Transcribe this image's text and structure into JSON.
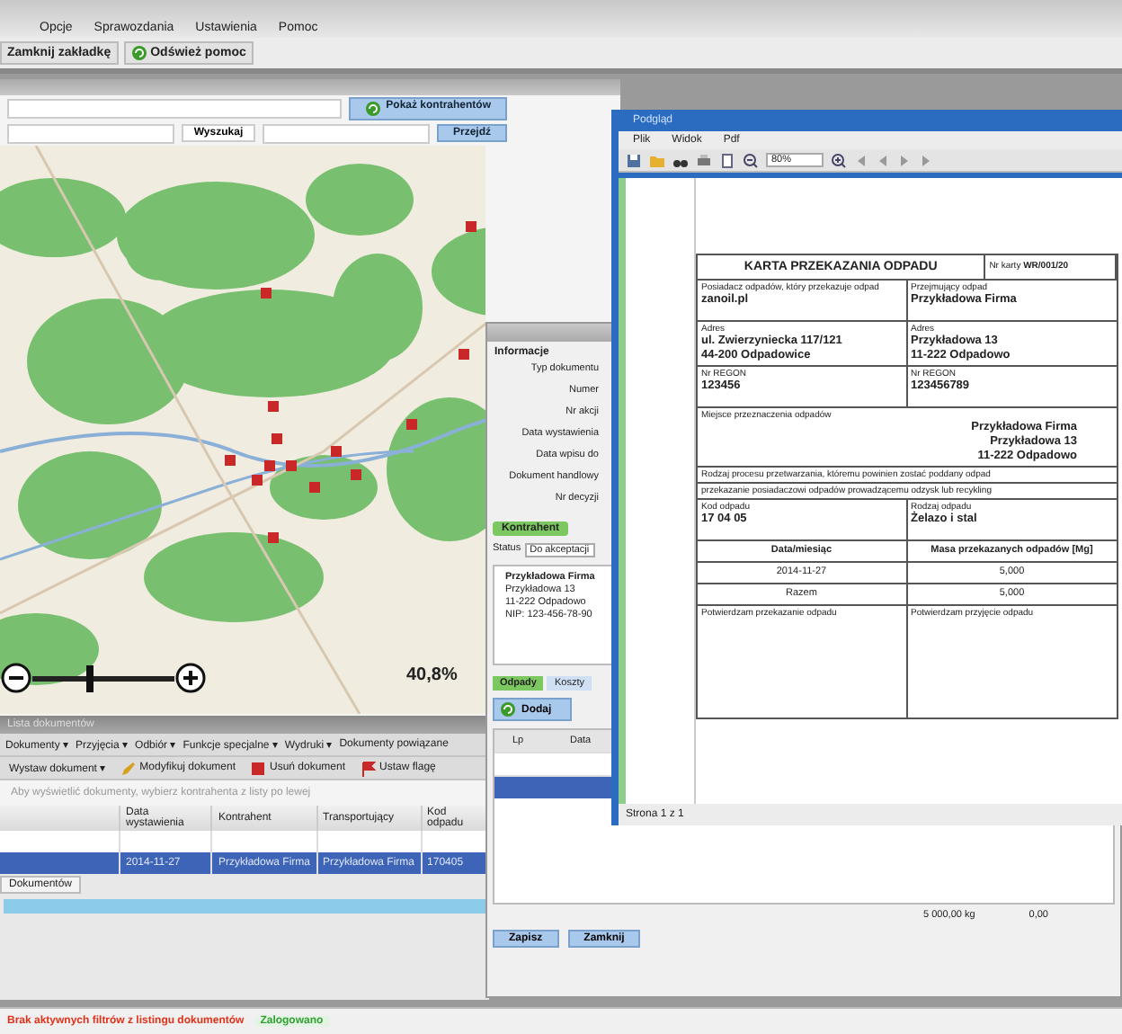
{
  "menu": [
    {
      "label": "Opcje"
    },
    {
      "label": "Sprawozdania"
    },
    {
      "label": "Ustawienia"
    },
    {
      "label": "Pomoc"
    }
  ],
  "toolbar": [
    {
      "label": "Zamknij zakładkę",
      "kind": "plain"
    },
    {
      "label": "Odśwież pomoc",
      "kind": "refresh"
    }
  ],
  "map": {
    "filter_button": "Pokaż kontrahentów",
    "search_button": "Wyszukaj",
    "go_button": "Przejdź",
    "zoom": {
      "level": 0.4
    },
    "scale": "40,8%"
  },
  "documents": {
    "title": "Lista dokumentów",
    "menu": [
      "Dokumenty ▾",
      "Przyjęcia ▾",
      "Odbiór ▾",
      "Funkcje specjalne ▾",
      "Wydruki ▾",
      "Dokumenty powiązane"
    ],
    "actions": [
      {
        "label": "Wystaw dokument ▾",
        "kind": "plain"
      },
      {
        "label": "Modyfikuj dokument",
        "kind": "edit"
      },
      {
        "label": "Usuń dokument",
        "kind": "delete"
      },
      {
        "label": "Ustaw flagę",
        "kind": "flag"
      }
    ],
    "hint": "Aby wyświetlić dokumenty, wybierz kontrahenta z listy po lewej",
    "columns": [
      "Data wystawienia",
      "Kontrahent",
      "Transportujący",
      "Kod odpadu"
    ],
    "rows": [
      {
        "cells": [
          "2014-11-27",
          "Przykładowa Firma",
          "Przykładowa Firma",
          "170405"
        ],
        "selected": true
      }
    ],
    "tab": "Dokumentów"
  },
  "dialog": {
    "section": "Informacje",
    "fields": [
      "Typ dokumentu",
      "Numer",
      "Nr akcji",
      "Data wystawienia",
      "Data wpisu do",
      "Dokument handlowy",
      "Nr decyzji"
    ],
    "contractor_tag": "Kontrahent",
    "status_label": "Status",
    "status_value": "Do akceptacji",
    "address": [
      "Przykładowa Firma",
      "Przykładowa 13",
      "11-222 Odpadowo",
      "NIP: 123-456-78-90"
    ],
    "tabs": [
      {
        "label": "Odpady",
        "selected": true
      },
      {
        "label": "Koszty",
        "selected": false
      }
    ],
    "add_button": "Dodaj",
    "grid_columns": [
      "Lp",
      "Data"
    ],
    "grid_rows": [
      {
        "selected": false
      },
      {
        "selected": true
      }
    ],
    "totals": [
      "5 000,00 kg",
      "0,00"
    ],
    "buttons": [
      "Zapisz",
      "Zamknij"
    ]
  },
  "viewer": {
    "title": "Podgląd",
    "menu": [
      "Plik",
      "Widok",
      "Pdf"
    ],
    "zoom": "80%",
    "status": "Strona 1 z 1",
    "form": {
      "title": "KARTA PRZEKAZANIA ODPADU",
      "number_label": "Nr karty",
      "number": "WR/001/20",
      "blocks": [
        [
          {
            "label": "Posiadacz odpadów, który przekazuje odpad",
            "lines": [
              "zanoil.pl"
            ]
          },
          {
            "label": "Przejmujący odpad",
            "lines": [
              "Przykładowa Firma"
            ]
          }
        ],
        [
          {
            "label": "Adres",
            "lines": [
              "ul. Zwierzyniecka 117/121",
              "44-200 Odpadowice"
            ]
          },
          {
            "label": "Adres",
            "lines": [
              "Przykładowa 13",
              "11-222 Odpadowo"
            ]
          }
        ],
        [
          {
            "label": "Nr REGON",
            "lines": [
              "123456"
            ]
          },
          {
            "label": "Nr REGON",
            "lines": [
              "123456789"
            ]
          }
        ],
        [
          {
            "label": "Miejsce przeznaczenia odpadów",
            "lines": [
              "Przykładowa Firma",
              "Przykładowa 13",
              "11-222 Odpadowo"
            ]
          }
        ],
        [
          {
            "label": "Rodzaj procesu przetwarzania, któremu powinien zostać poddany odpad"
          }
        ],
        [
          {
            "label": "przekazanie posiadaczowi odpadów prowadzącemu odzysk lub recykling"
          }
        ],
        [
          {
            "label": "Kod odpadu",
            "lines": [
              "17 04 05"
            ]
          },
          {
            "label": "Rodzaj odpadu",
            "lines": [
              "Żelazo i stal"
            ]
          }
        ]
      ],
      "mass_columns": [
        "Data/miesiąc",
        "Masa przekazanych odpadów [Mg]"
      ],
      "mass_rows": [
        [
          "2014-11-27",
          "5,000"
        ],
        [
          "Razem",
          "5,000"
        ]
      ],
      "confirm": [
        "Potwierdzam przekazanie odpadu",
        "Potwierdzam przyjęcie odpadu"
      ]
    }
  },
  "status": {
    "message": "Brak aktywnych filtrów z listingu dokumentów",
    "state": "Zalogowano"
  }
}
